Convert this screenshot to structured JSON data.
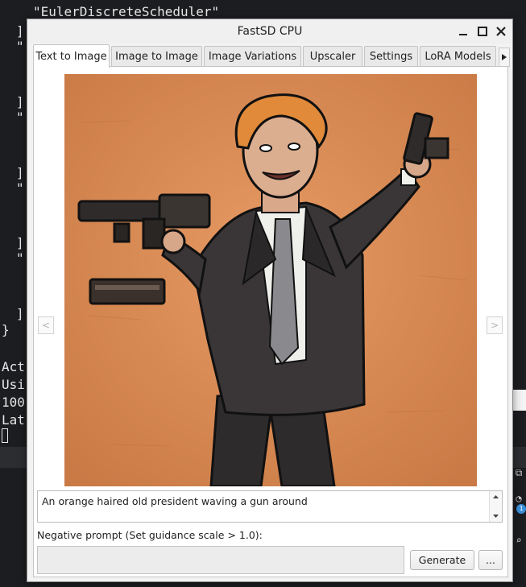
{
  "terminal": {
    "lines": [
      "\"EulerDiscreteScheduler\"",
      "]",
      "\"",
      "]",
      "\"",
      "]",
      "\"",
      "]",
      "\"",
      "]",
      "}",
      "Act",
      "Usi",
      "100",
      "Lat"
    ]
  },
  "window": {
    "title": "FastSD CPU",
    "tabs": [
      {
        "label": "Text to Image",
        "active": true
      },
      {
        "label": "Image to Image",
        "active": false
      },
      {
        "label": "Image Variations",
        "active": false
      },
      {
        "label": "Upscaler",
        "active": false
      },
      {
        "label": "Settings",
        "active": false
      },
      {
        "label": "LoRA Models",
        "active": false
      }
    ],
    "prev_arrow": "<",
    "next_arrow": ">",
    "prompt": {
      "value": "An orange haired old president waving a gun around"
    },
    "negative_prompt": {
      "label": "Negative prompt (Set guidance scale > 1.0):",
      "value": ""
    },
    "generate_label": "Generate",
    "more_label": "...",
    "colors": {
      "image_background": "#d88a55",
      "window_background": "#f2f2f2"
    }
  }
}
